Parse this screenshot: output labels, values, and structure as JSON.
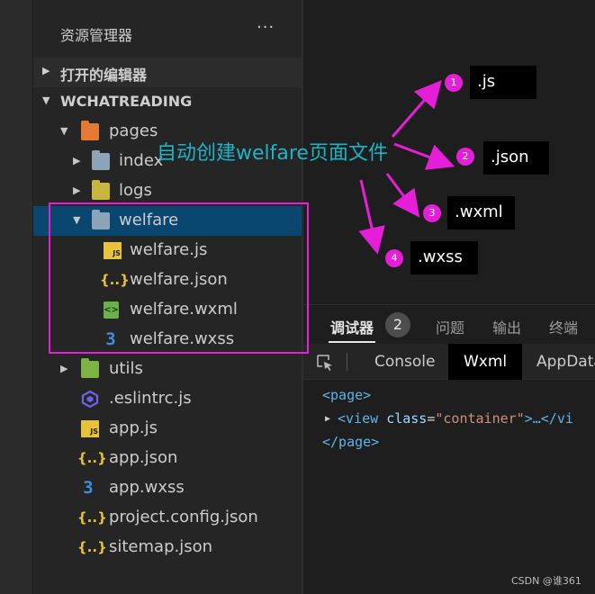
{
  "explorer": {
    "title": "资源管理器",
    "more": "···",
    "open_editors": "打开的编辑器",
    "project": "WCHATREADING"
  },
  "tree": {
    "pages": "pages",
    "index": "index",
    "logs": "logs",
    "welfare": "welfare",
    "welfare_js": "welfare.js",
    "welfare_json": "welfare.json",
    "welfare_wxml": "welfare.wxml",
    "welfare_wxss": "welfare.wxss",
    "utils": "utils",
    "eslintrc": ".eslintrc.js",
    "app_js": "app.js",
    "app_json": "app.json",
    "app_wxss": "app.wxss",
    "project_config": "project.config.json",
    "sitemap": "sitemap.json"
  },
  "icons": {
    "js_badge": "JS",
    "json_glyph": "{..}",
    "wxss_glyph": "3",
    "wxml_glyph": "<>"
  },
  "annotation": {
    "caption": "自动创建welfare页面文件",
    "labels": [
      {
        "num": "1",
        "ext": ".js"
      },
      {
        "num": "2",
        "ext": ".json"
      },
      {
        "num": "3",
        "ext": ".wxml"
      },
      {
        "num": "4",
        "ext": ".wxss"
      }
    ],
    "accent_color": "#e51ed8",
    "caption_color": "#1eb3c7"
  },
  "debugger": {
    "tabs": [
      "调试器",
      "问题",
      "输出",
      "终端"
    ],
    "badge": "2",
    "tool_tabs": [
      "Console",
      "Wxml",
      "AppData"
    ],
    "code": {
      "open_page": "<page>",
      "view_open": "<view",
      "attr_name": "class",
      "equals": "=",
      "attr_value": "\"container\"",
      "view_rest": ">…</vi",
      "close_page": "</page>"
    }
  },
  "watermark": "CSDN @谁361",
  "colors": {
    "selection": "#094771",
    "folder_pages": "#e37933",
    "folder_plain": "#8da4b8",
    "folder_logs": "#c8b640",
    "folder_utils": "#7cb342",
    "js_yellow": "#e8c33a",
    "css_blue": "#3b8ee0"
  }
}
